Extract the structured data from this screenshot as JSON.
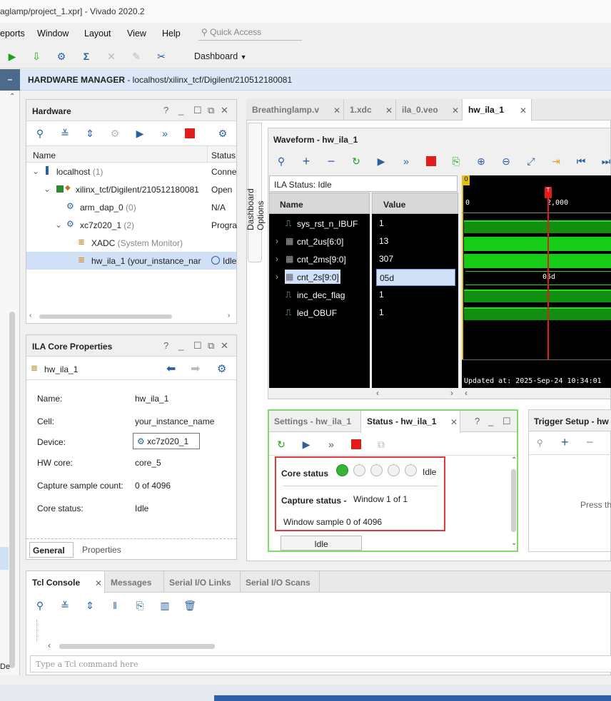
{
  "window": {
    "title": "aglamp/project_1.xpr] - Vivado 2020.2"
  },
  "menu": {
    "items": [
      "eports",
      "Window",
      "Layout",
      "View",
      "Help"
    ],
    "quick_access": "Quick Access"
  },
  "toolbar": {
    "layout_select": "Dashboard"
  },
  "banner": {
    "title": "HARDWARE MANAGER",
    "path": " - localhost/xilinx_tcf/Digilent/210512180081",
    "collapse": "–"
  },
  "hardware": {
    "title": "Hardware",
    "col_name": "Name",
    "col_status": "Status",
    "rows": [
      {
        "name": "localhost",
        "count": " (1)",
        "status": "Conne"
      },
      {
        "name": "xilinx_tcf/Digilent/210512180081",
        "count": "",
        "status": "Open"
      },
      {
        "name": "arm_dap_0",
        "count": " (0)",
        "status": "N/A"
      },
      {
        "name": "xc7z020_1",
        "count": " (2)",
        "status": "Progra"
      },
      {
        "name": "XADC",
        "count": " (System Monitor)",
        "status": ""
      },
      {
        "name": "hw_ila_1",
        "count": " (your_instance_nar",
        "status": "Idle"
      }
    ]
  },
  "props": {
    "title": "ILA Core Properties",
    "object": "hw_ila_1",
    "fields": [
      {
        "label": "Name:",
        "value": "hw_ila_1"
      },
      {
        "label": "Cell:",
        "value": "your_instance_name"
      },
      {
        "label": "Device:",
        "value": "xc7z020_1"
      },
      {
        "label": "HW core:",
        "value": "core_5"
      },
      {
        "label": "Capture sample count:",
        "value": "0 of 4096"
      },
      {
        "label": "Core status:",
        "value": "Idle"
      }
    ],
    "tabs": [
      "General",
      "Properties"
    ]
  },
  "editor_tabs": [
    "Breathinglamp.v",
    "1.xdc",
    "ila_0.veo",
    "hw_ila_1"
  ],
  "dashboard_options": "Dashboard Options",
  "waveform": {
    "title": "Waveform - hw_ila_1",
    "ila_status": "ILA Status: Idle",
    "col_name": "Name",
    "col_value": "Value",
    "signals": [
      {
        "name": "sys_rst_n_IBUF",
        "value": "1"
      },
      {
        "name": "cnt_2us[6:0]",
        "value": "13"
      },
      {
        "name": "cnt_2ms[9:0]",
        "value": "307"
      },
      {
        "name": "cnt_2s[9:0]",
        "value": "05d"
      },
      {
        "name": "inc_dec_flag",
        "value": "1"
      },
      {
        "name": "led_OBUF",
        "value": "1"
      }
    ],
    "ruler_0": "0",
    "ruler_2000": "2,000",
    "marker_0": "0",
    "marker_t": "T",
    "bus_label": "05d",
    "updated": "Updated at: 2025-Sep-24 10:34:01"
  },
  "status_panel": {
    "tab_settings": "Settings - hw_ila_1",
    "tab_status": "Status - hw_ila_1",
    "core_status_label": "Core status",
    "core_status_value": "Idle",
    "capture_label": "Capture status -",
    "capture_value": "Window 1 of 1",
    "window_sample": "Window sample 0 of 4096",
    "idle_button": "Idle"
  },
  "trigger": {
    "title": "Trigger Setup - hw",
    "hint": "Press th"
  },
  "console": {
    "tabs": [
      "Tcl Console",
      "Messages",
      "Serial I/O Links",
      "Serial I/O Scans"
    ],
    "placeholder": "Type a Tcl command here",
    "side_label": "De"
  }
}
